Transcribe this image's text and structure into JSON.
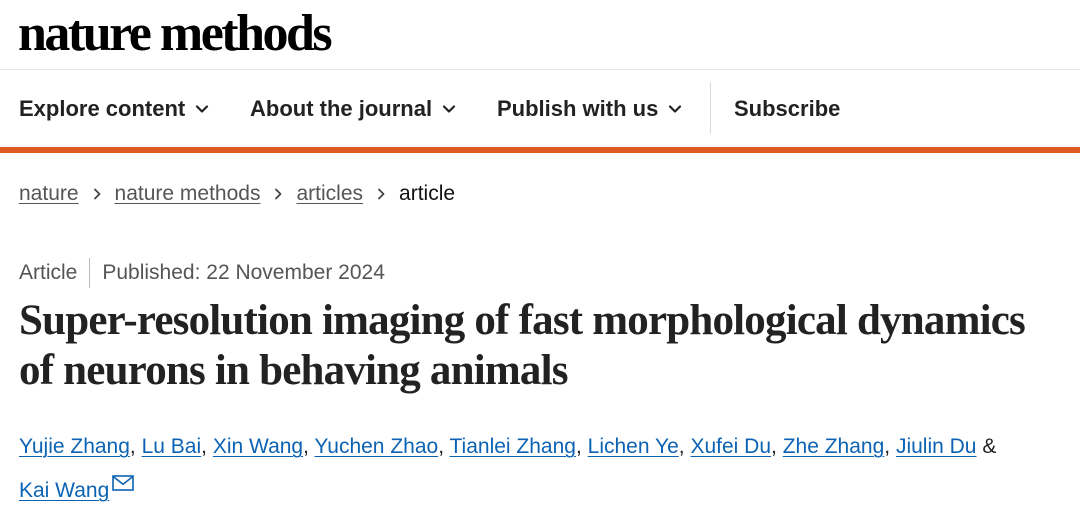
{
  "brand": {
    "logo_text": "nature methods"
  },
  "nav": {
    "items": [
      {
        "label": "Explore content",
        "icon": "chevron-down-icon"
      },
      {
        "label": "About the journal",
        "icon": "chevron-down-icon"
      },
      {
        "label": "Publish with us",
        "icon": "chevron-down-icon"
      }
    ],
    "subscribe_label": "Subscribe",
    "accent_color": "#e05a24"
  },
  "breadcrumb": {
    "items": [
      "nature",
      "nature methods",
      "articles"
    ],
    "current": "article",
    "separator_icon": "chevron-right-icon"
  },
  "article": {
    "type": "Article",
    "published": "Published: 22 November 2024",
    "title": "Super-resolution imaging of fast morphological dynamics of neurons in behaving animals",
    "authors": [
      "Yujie Zhang",
      "Lu Bai",
      "Xin Wang",
      "Yuchen Zhao",
      "Tianlei Zhang",
      "Lichen Ye",
      "Xufei Du",
      "Zhe Zhang",
      "Jiulin Du",
      "Kai Wang"
    ],
    "author_separator": ",",
    "last_author_joiner": "&",
    "corresponding_icon": "mail-icon",
    "link_color": "#0c63b4"
  }
}
